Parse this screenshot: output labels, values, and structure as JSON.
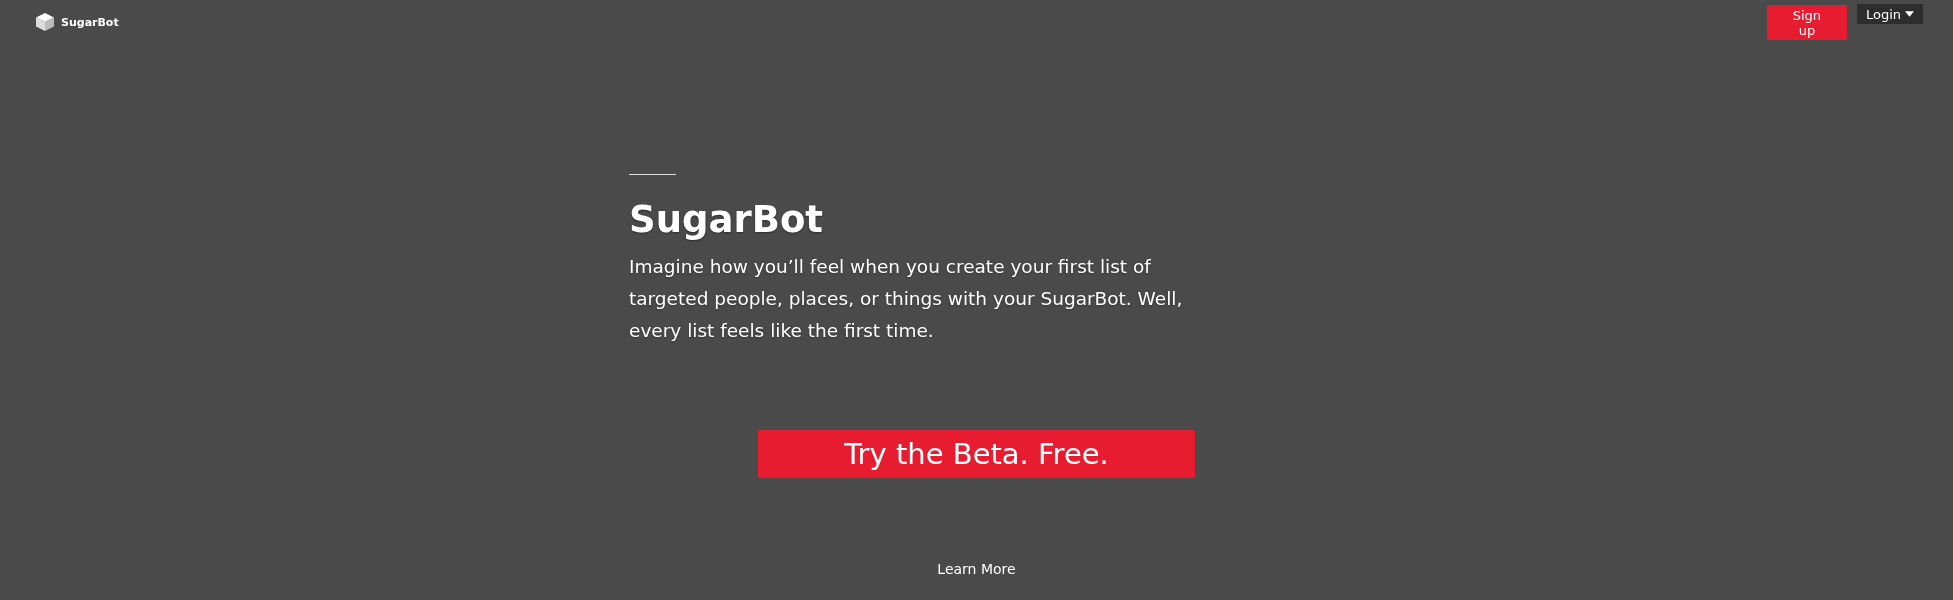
{
  "header": {
    "brand": "SugarBot",
    "buttons": [
      {
        "label": "Sign up",
        "kind": "primary"
      },
      {
        "label": "Login",
        "kind": "dropdown"
      }
    ]
  },
  "hero": {
    "title": "SugarBot",
    "text": "Imagine how you’ll feel when you create your first list of targeted people, places, or things with your SugarBot. Well, every list feels like the first time.",
    "cta": "Try the Beta. Free.",
    "link": "Learn More"
  }
}
